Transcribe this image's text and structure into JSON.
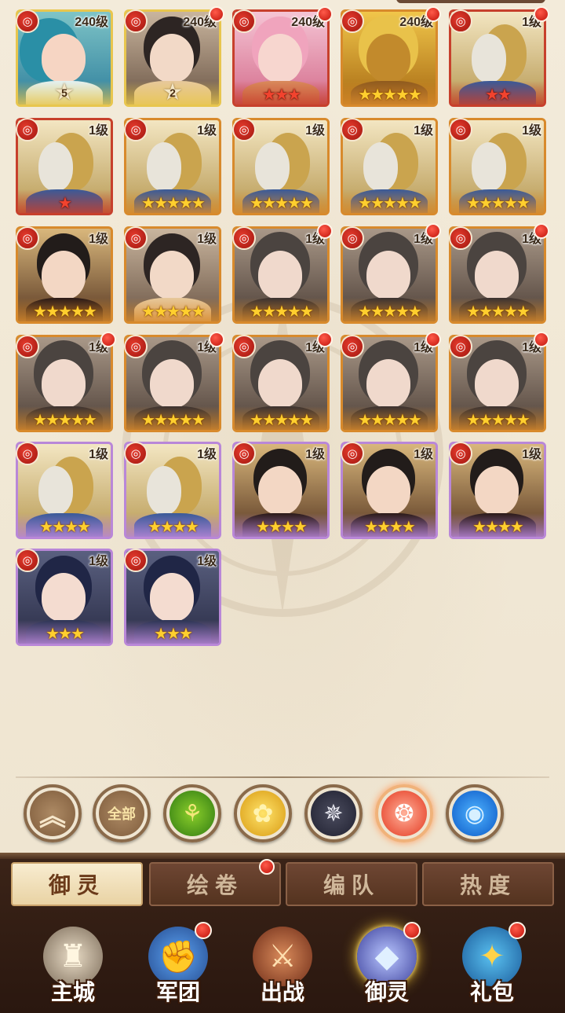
{
  "cards": [
    {
      "level": "240级",
      "rarity": "gold",
      "portrait": "blue",
      "star_badge": "5",
      "dot": false,
      "stars": 0,
      "star_color": "gold"
    },
    {
      "level": "240级",
      "rarity": "gold",
      "portrait": "dark",
      "star_badge": "2",
      "dot": true,
      "stars": 0,
      "star_color": "gold"
    },
    {
      "level": "240级",
      "rarity": "red",
      "portrait": "pink",
      "star_badge": "",
      "dot": true,
      "stars": 3,
      "star_color": "red"
    },
    {
      "level": "240级",
      "rarity": "orange",
      "portrait": "golden",
      "star_badge": "",
      "dot": true,
      "stars": 5,
      "star_color": "gold"
    },
    {
      "level": "1级",
      "rarity": "red",
      "portrait": "armor",
      "star_badge": "",
      "dot": true,
      "stars": 2,
      "star_color": "red"
    },
    {
      "level": "1级",
      "rarity": "red",
      "portrait": "armor",
      "star_badge": "",
      "dot": false,
      "stars": 1,
      "star_color": "red"
    },
    {
      "level": "1级",
      "rarity": "orange",
      "portrait": "armor",
      "star_badge": "",
      "dot": false,
      "stars": 5,
      "star_color": "gold"
    },
    {
      "level": "1级",
      "rarity": "orange",
      "portrait": "armor",
      "star_badge": "",
      "dot": false,
      "stars": 5,
      "star_color": "gold"
    },
    {
      "level": "1级",
      "rarity": "orange",
      "portrait": "armor",
      "star_badge": "",
      "dot": false,
      "stars": 5,
      "star_color": "gold"
    },
    {
      "level": "1级",
      "rarity": "orange",
      "portrait": "armor",
      "star_badge": "",
      "dot": false,
      "stars": 5,
      "star_color": "gold"
    },
    {
      "level": "1级",
      "rarity": "orange",
      "portrait": "mask",
      "star_badge": "",
      "dot": false,
      "stars": 5,
      "star_color": "gold"
    },
    {
      "level": "1级",
      "rarity": "orange",
      "portrait": "dark",
      "star_badge": "",
      "dot": false,
      "stars": 5,
      "star_color": "gold"
    },
    {
      "level": "1级",
      "rarity": "orange",
      "portrait": "grey",
      "star_badge": "",
      "dot": true,
      "stars": 5,
      "star_color": "gold"
    },
    {
      "level": "1级",
      "rarity": "orange",
      "portrait": "grey",
      "star_badge": "",
      "dot": true,
      "stars": 5,
      "star_color": "gold"
    },
    {
      "level": "1级",
      "rarity": "orange",
      "portrait": "grey",
      "star_badge": "",
      "dot": true,
      "stars": 5,
      "star_color": "gold"
    },
    {
      "level": "1级",
      "rarity": "orange",
      "portrait": "grey",
      "star_badge": "",
      "dot": true,
      "stars": 5,
      "star_color": "gold"
    },
    {
      "level": "1级",
      "rarity": "orange",
      "portrait": "grey",
      "star_badge": "",
      "dot": true,
      "stars": 5,
      "star_color": "gold"
    },
    {
      "level": "1级",
      "rarity": "orange",
      "portrait": "grey",
      "star_badge": "",
      "dot": true,
      "stars": 5,
      "star_color": "gold"
    },
    {
      "level": "1级",
      "rarity": "orange",
      "portrait": "grey",
      "star_badge": "",
      "dot": true,
      "stars": 5,
      "star_color": "gold"
    },
    {
      "level": "1级",
      "rarity": "orange",
      "portrait": "grey",
      "star_badge": "",
      "dot": true,
      "stars": 5,
      "star_color": "gold"
    },
    {
      "level": "1级",
      "rarity": "purple",
      "portrait": "armor",
      "star_badge": "",
      "dot": false,
      "stars": 4,
      "star_color": "gold"
    },
    {
      "level": "1级",
      "rarity": "purple",
      "portrait": "armor",
      "star_badge": "",
      "dot": false,
      "stars": 4,
      "star_color": "gold"
    },
    {
      "level": "1级",
      "rarity": "purple",
      "portrait": "mask",
      "star_badge": "",
      "dot": false,
      "stars": 4,
      "star_color": "gold"
    },
    {
      "level": "1级",
      "rarity": "purple",
      "portrait": "mask",
      "star_badge": "",
      "dot": false,
      "stars": 4,
      "star_color": "gold"
    },
    {
      "level": "1级",
      "rarity": "purple",
      "portrait": "mask",
      "star_badge": "",
      "dot": false,
      "stars": 4,
      "star_color": "gold"
    },
    {
      "level": "1级",
      "rarity": "purple",
      "portrait": "glass",
      "star_badge": "",
      "dot": false,
      "stars": 3,
      "star_color": "gold"
    },
    {
      "level": "1级",
      "rarity": "purple",
      "portrait": "glass",
      "star_badge": "",
      "dot": false,
      "stars": 3,
      "star_color": "gold"
    }
  ],
  "filters": [
    {
      "name": "collapse",
      "label": "︽",
      "cls": "f-up"
    },
    {
      "name": "all",
      "label": "全部",
      "cls": "f-all"
    },
    {
      "name": "faction-green",
      "label": "⚘",
      "cls": "f-green"
    },
    {
      "name": "faction-yellow",
      "label": "✿",
      "cls": "f-yellow"
    },
    {
      "name": "faction-dark",
      "label": "✵",
      "cls": "f-dark"
    },
    {
      "name": "faction-red",
      "label": "❂",
      "cls": "f-red"
    },
    {
      "name": "faction-blue",
      "label": "◉",
      "cls": "f-blue"
    }
  ],
  "tabs": [
    {
      "label": "御灵",
      "active": true,
      "dot": false
    },
    {
      "label": "绘卷",
      "active": false,
      "dot": true
    },
    {
      "label": "编队",
      "active": false,
      "dot": false
    },
    {
      "label": "热度",
      "active": false,
      "dot": false
    }
  ],
  "nav": [
    {
      "label": "主城",
      "icon": "city-icon",
      "cls": "n-city",
      "glyph": "♜",
      "dot": false,
      "active": false
    },
    {
      "label": "军团",
      "icon": "legion-icon",
      "cls": "n-legion",
      "glyph": "✊",
      "dot": true,
      "active": false
    },
    {
      "label": "出战",
      "icon": "battle-icon",
      "cls": "n-battle",
      "glyph": "⚔",
      "dot": false,
      "active": false
    },
    {
      "label": "御灵",
      "icon": "crystal-icon",
      "cls": "n-yuling",
      "glyph": "◆",
      "dot": true,
      "active": true
    },
    {
      "label": "礼包",
      "icon": "gift-chest-icon",
      "cls": "n-gift",
      "glyph": "✦",
      "dot": true,
      "active": false
    }
  ],
  "faction_glyph": "◎"
}
